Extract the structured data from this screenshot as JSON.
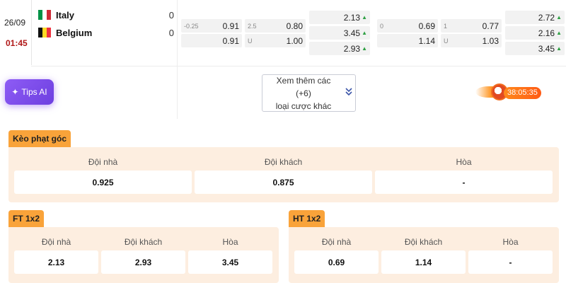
{
  "match": {
    "date": "26/09",
    "time": "01:45",
    "home": {
      "name": "Italy",
      "score": "0",
      "flag_colors": [
        "#009246",
        "#ffffff",
        "#ce2b37"
      ]
    },
    "away": {
      "name": "Belgium",
      "score": "0",
      "flag_colors": [
        "#111111",
        "#fdda24",
        "#ef3340"
      ]
    }
  },
  "odds": {
    "ft_handicap": [
      {
        "label": "-0.25",
        "value": "0.91"
      },
      {
        "label": "",
        "value": "0.91"
      }
    ],
    "ft_overunder": [
      {
        "label": "2.5",
        "value": "0.80"
      },
      {
        "label": "U",
        "value": "1.00"
      }
    ],
    "ft_1x2": [
      {
        "value": "2.13",
        "arrow": "▲"
      },
      {
        "value": "3.45",
        "arrow": "▲"
      },
      {
        "value": "2.93",
        "arrow": "▲"
      }
    ],
    "ht_handicap": [
      {
        "label": "0",
        "value": "0.69"
      },
      {
        "label": "",
        "value": "1.14"
      }
    ],
    "ht_overunder": [
      {
        "label": "1",
        "value": "0.77"
      },
      {
        "label": "U",
        "value": "1.03"
      }
    ],
    "ht_1x2": [
      {
        "value": "2.72",
        "arrow": "▲"
      },
      {
        "value": "2.16",
        "arrow": "▲"
      },
      {
        "value": "3.45",
        "arrow": "▲"
      }
    ]
  },
  "tips_label": "Tips AI",
  "more": {
    "line1": "Xem thêm các (+6)",
    "line2": "loại cược khác"
  },
  "live_timer": "38:05:35",
  "corner": {
    "title": "Kèo phạt góc",
    "headers": [
      "Đội nhà",
      "Đội khách",
      "Hòa"
    ],
    "values": [
      "0.925",
      "0.875",
      "-"
    ]
  },
  "ft": {
    "title": "FT 1x2",
    "headers": [
      "Đội nhà",
      "Đội khách",
      "Hòa"
    ],
    "values": [
      "2.13",
      "2.93",
      "3.45"
    ]
  },
  "ht": {
    "title": "HT 1x2",
    "headers": [
      "Đội nhà",
      "Đội khách",
      "Hòa"
    ],
    "values": [
      "0.69",
      "1.14",
      "-"
    ]
  },
  "colors": {
    "accent": "#f9a33a",
    "panel": "#fdeee0",
    "time_red": "#b01818",
    "up_arrow": "#2ea043",
    "tips_purple": "#7c4ae8"
  }
}
